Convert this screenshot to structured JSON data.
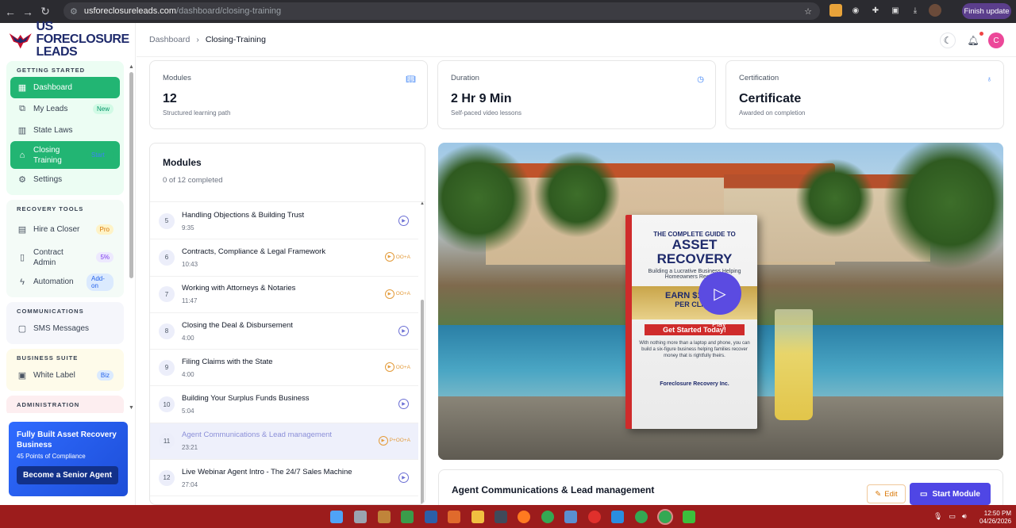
{
  "browser": {
    "url_host": "usforeclosureleads.com",
    "url_path": "/dashboard/closing-training",
    "finish_update": "Finish update"
  },
  "logo": {
    "line1": "US FORECLOSURE",
    "line2": "LEADS"
  },
  "sidebar": {
    "sections": [
      {
        "title": "GETTING STARTED",
        "bg": "#ecfdf3",
        "items": [
          {
            "label": "Dashboard",
            "icon": "grid-icon",
            "active": true
          },
          {
            "label": "My Leads",
            "icon": "leads-icon",
            "badge": "New",
            "badge_bg": "#d1fae5",
            "badge_fg": "#059669"
          },
          {
            "label": "State Laws",
            "icon": "map-icon"
          },
          {
            "label": "Closing Training",
            "icon": "graduation-cap-icon",
            "active": true,
            "badge": "Start",
            "badge_bg": "#22b573",
            "badge_fg": "#3b82f6"
          },
          {
            "label": "Settings",
            "icon": "gear-icon"
          }
        ]
      },
      {
        "title": "RECOVERY TOOLS",
        "bg": "#f4fbf7",
        "items": [
          {
            "label": "Hire a Closer",
            "icon": "briefcase-icon",
            "badge": "Pro",
            "badge_bg": "#fef3c7",
            "badge_fg": "#d97706"
          },
          {
            "label": "Contract Admin",
            "icon": "document-icon",
            "badge": "5%",
            "badge_bg": "#ede9fe",
            "badge_fg": "#7c3aed"
          },
          {
            "label": "Automation",
            "icon": "lightning-icon",
            "badge": "Add-on",
            "badge_bg": "#dbeafe",
            "badge_fg": "#2563eb"
          }
        ]
      },
      {
        "title": "COMMUNICATIONS",
        "bg": "#f5f6fb",
        "items": [
          {
            "label": "SMS Messages",
            "icon": "message-icon"
          }
        ]
      },
      {
        "title": "BUSINESS SUITE",
        "bg": "#fefbea",
        "items": [
          {
            "label": "White Label",
            "icon": "label-icon",
            "badge": "Biz",
            "badge_bg": "#dbeafe",
            "badge_fg": "#2563eb"
          }
        ]
      },
      {
        "title": "ADMINISTRATION",
        "bg": "#fdeef0",
        "items": []
      }
    ]
  },
  "promo": {
    "title": "Fully Built Asset Recovery Business",
    "subtitle": "45 Points of Compliance",
    "button": "Become a Senior Agent"
  },
  "breadcrumb": {
    "root": "Dashboard",
    "current": "Closing-Training"
  },
  "user": {
    "initial": "C"
  },
  "stats": [
    {
      "label": "Modules",
      "value": "12",
      "sub": "Structured learning path",
      "icon": "book-icon"
    },
    {
      "label": "Duration",
      "value": "2 Hr 9 Min",
      "sub": "Self-paced video lessons",
      "icon": "clock-icon"
    },
    {
      "label": "Certification",
      "value": "Certificate",
      "sub": "Awarded on completion",
      "icon": "award-icon"
    }
  ],
  "modules": {
    "title": "Modules",
    "progress": "0 of 12 completed",
    "items": [
      {
        "num": "5",
        "title": "Handling Objections & Building Trust",
        "duration": "9:35",
        "tag": ""
      },
      {
        "num": "6",
        "title": "Contracts, Compliance & Legal Framework",
        "duration": "10:43",
        "tag": "OO+A"
      },
      {
        "num": "7",
        "title": "Working with Attorneys & Notaries",
        "duration": "11:47",
        "tag": "OO+A"
      },
      {
        "num": "8",
        "title": "Closing the Deal & Disbursement",
        "duration": "4:00",
        "tag": ""
      },
      {
        "num": "9",
        "title": "Filing Claims with the State",
        "duration": "4:00",
        "tag": "OO+A"
      },
      {
        "num": "10",
        "title": "Building Your Surplus Funds Business",
        "duration": "5:04",
        "tag": ""
      },
      {
        "num": "11",
        "title": "Agent Communications & Lead management",
        "duration": "23:21",
        "tag": "P+OO+A",
        "selected": true
      },
      {
        "num": "12",
        "title": "Live Webinar Agent Intro - The 24/7 Sales Machine",
        "duration": "27:04",
        "tag": ""
      }
    ]
  },
  "video": {
    "book": {
      "line1": "THE COMPLETE GUIDE TO",
      "line2": "ASSET RECOVERY",
      "line3": "Building a Lucrative Business Helping Homeowners Recover...",
      "earn": "EARN $10,000",
      "per": "PER CLAIM",
      "cta": "Get Started Today!",
      "body": "With nothing more than a laptop and phone, you can build a six-figure business helping families recover money that is rightfully theirs.",
      "publisher": "Foreclosure Recovery Inc."
    },
    "play_label": "Play"
  },
  "detail": {
    "title": "Agent Communications & Lead management",
    "edit": "Edit",
    "start": "Start Module"
  },
  "taskbar": {
    "time": "12:50 PM",
    "date": "04/26/2026"
  }
}
